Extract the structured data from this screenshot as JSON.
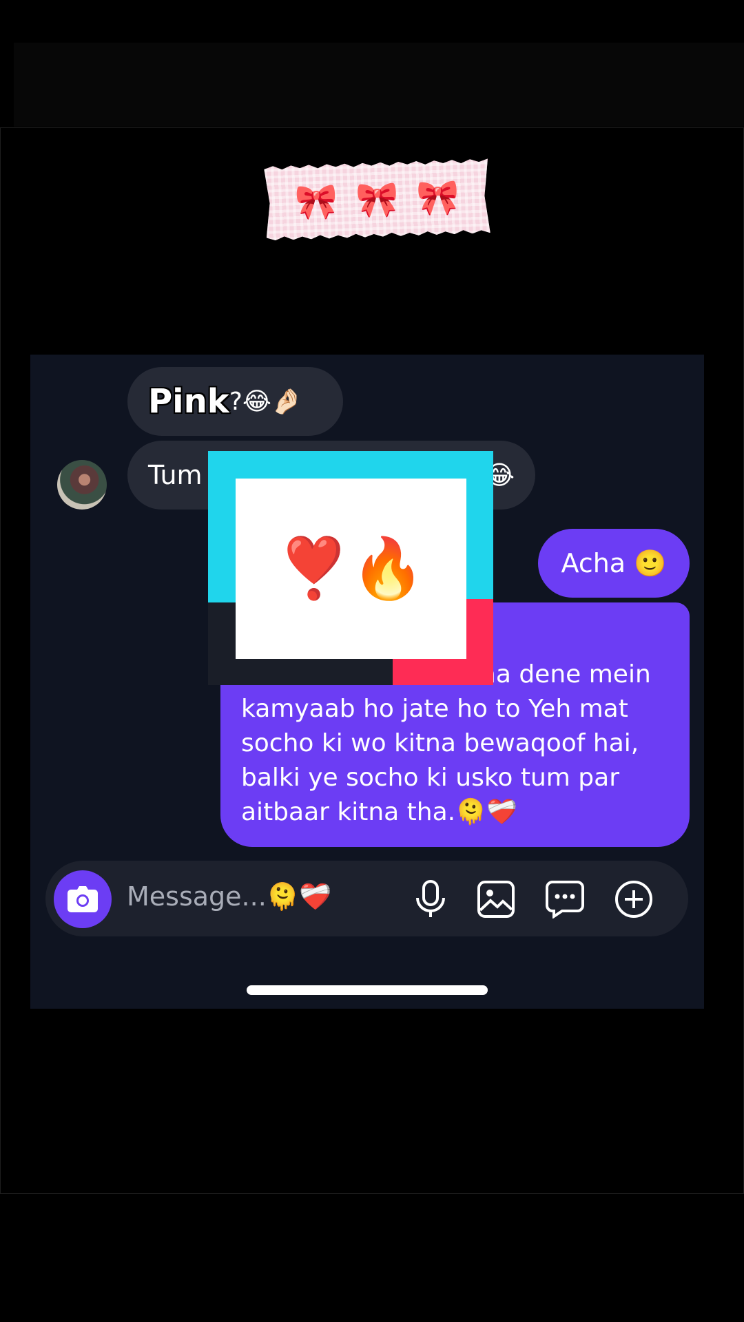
{
  "decoration": {
    "washi_tape": {
      "bows": [
        "🎀",
        "🎀",
        "🎀"
      ],
      "color": "#f6d4df"
    }
  },
  "chat": {
    "incoming": {
      "msg1_word": "Pink",
      "msg1_rest": "?😂🤌🏻",
      "msg2_start": "Tum",
      "msg2_end": "😂"
    },
    "outgoing": {
      "msg1": "Acha 🙂",
      "long_lines": [
        "ha dene mein",
        "kamyaab ho jate ho to Yeh mat",
        "socho ki wo kitna bewaqoof hai,",
        "balki ye socho ki usko tum par",
        "aitbaar kitna tha.🫠❤️‍🩹"
      ]
    },
    "colors": {
      "outgoing_bubble": "#6c3df4",
      "incoming_bubble": "#262a36",
      "background": "#0f1421"
    }
  },
  "composer": {
    "placeholder": "Message...🫠❤️‍🩹",
    "icons": [
      "camera-icon",
      "microphone-icon",
      "gallery-icon",
      "sticker-chat-icon",
      "plus-circle-icon"
    ]
  },
  "overlay": {
    "emojis": "❣️🔥",
    "colors": {
      "cyan": "#20d5ec",
      "red": "#fe2c55"
    }
  }
}
